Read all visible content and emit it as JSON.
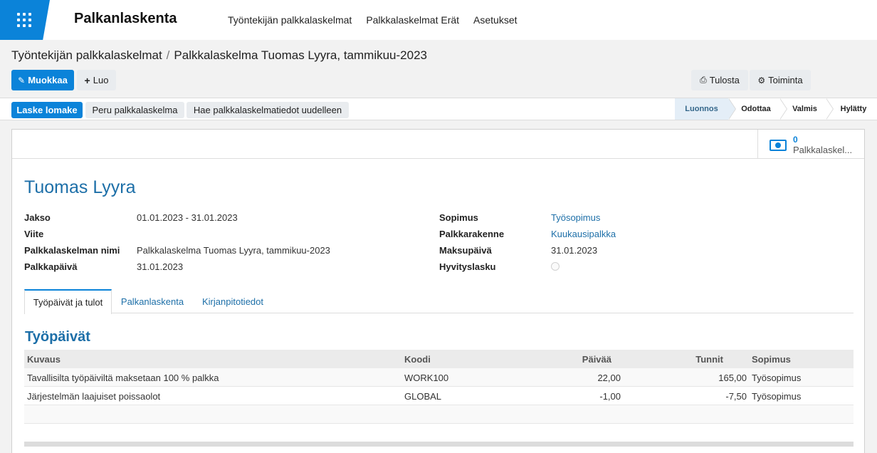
{
  "app": {
    "brand": "Palkanlaskenta",
    "menu": [
      "Työntekijän palkkalaskelmat",
      "Palkkalaskelmat Erät",
      "Asetukset"
    ]
  },
  "breadcrumb": {
    "parent": "Työntekijän palkkalaskelmat",
    "separator": "/",
    "current": "Palkkalaskelma Tuomas Lyyra, tammikuu-2023"
  },
  "toolbar": {
    "edit_label": "Muokkaa",
    "create_label": "Luo",
    "print_label": "Tulosta",
    "action_label": "Toiminta"
  },
  "statusbar": {
    "compute_label": "Laske lomake",
    "cancel_label": "Peru palkkalaskelma",
    "refresh_label": "Hae palkkalaskelmatiedot uudelleen",
    "stages": [
      "Luonnos",
      "Odottaa",
      "Valmis",
      "Hylätty"
    ],
    "active_stage": "Luonnos"
  },
  "smart_button": {
    "value": "0",
    "label": "Palkkalaskel..."
  },
  "record": {
    "name": "Tuomas Lyyra",
    "left_fields": [
      {
        "label": "Jakso",
        "value": "01.01.2023 - 31.01.2023"
      },
      {
        "label": "Viite",
        "value": ""
      },
      {
        "label": "Palkkalaskelman nimi",
        "value": "Palkkalaskelma Tuomas Lyyra, tammikuu-2023"
      },
      {
        "label": "Palkkapäivä",
        "value": "31.01.2023"
      }
    ],
    "right_fields": [
      {
        "label": "Sopimus",
        "value": "Työsopimus"
      },
      {
        "label": "Palkkarakenne",
        "value": "Kuukausipalkka"
      },
      {
        "label": "Maksupäivä",
        "value": "31.01.2023"
      },
      {
        "label": "Hyvityslasku",
        "value": ""
      }
    ]
  },
  "tabs": [
    "Työpäivät ja tulot",
    "Palkanlaskenta",
    "Kirjanpitotiedot"
  ],
  "section_title": "Työpäivät",
  "table": {
    "columns": [
      "Kuvaus",
      "Koodi",
      "Päivää",
      "Tunnit",
      "Sopimus"
    ],
    "rows": [
      [
        "Tavallisilta työpäiviltä maksetaan 100 % palkka",
        "WORK100",
        "22,00",
        "165,00",
        "Työsopimus"
      ],
      [
        "Järjestelmän laajuiset poissaolot",
        "GLOBAL",
        "-1,00",
        "-7,50",
        "Työsopimus"
      ]
    ]
  },
  "colors": {
    "primary": "#0b83d9",
    "link": "#1d6fa8",
    "active_stage_bg": "#e4eef7"
  }
}
